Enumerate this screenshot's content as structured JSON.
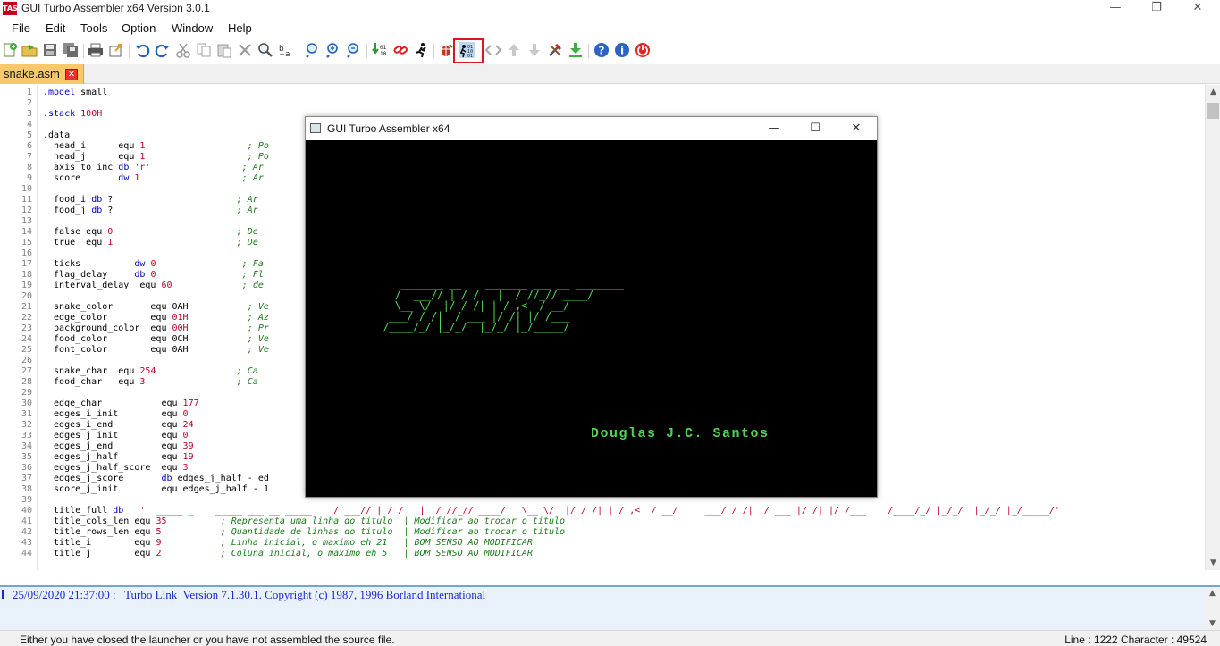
{
  "window": {
    "title": "GUI Turbo Assembler x64 Version 3.0.1",
    "app_icon_text": "TASM",
    "minimize": "—",
    "maximize": "❐",
    "close": "✕"
  },
  "menu": [
    "File",
    "Edit",
    "Tools",
    "Option",
    "Window",
    "Help"
  ],
  "toolbar": {
    "icons": [
      "new-file-icon",
      "open-file-icon",
      "save-icon",
      "save-all-icon",
      "print-icon",
      "export-icon",
      "undo-icon",
      "redo-icon",
      "cut-icon",
      "copy-icon",
      "paste-icon",
      "delete-icon",
      "find-icon",
      "replace-icon",
      "zoom-in-icon",
      "zoom-reset-icon",
      "zoom-out-icon",
      "assemble-icon",
      "link-icon",
      "run-icon",
      "debug-icon",
      "launcher-icon",
      "navigate-icon",
      "step-up-icon",
      "step-down-icon",
      "build-tools-icon",
      "download-icon",
      "help-icon",
      "info-icon",
      "power-icon"
    ],
    "selected": "launcher-icon"
  },
  "tab": {
    "label": "snake.asm",
    "close": "✕"
  },
  "editor": {
    "lines": [
      {
        "n": "1",
        "html": "<span class='dir'>.model</span> small"
      },
      {
        "n": "2",
        "html": ""
      },
      {
        "n": "3",
        "html": "<span class='dir'>.stack</span> <span class='num'>100H</span>"
      },
      {
        "n": "4",
        "html": ""
      },
      {
        "n": "5",
        "html": ".data"
      },
      {
        "n": "6",
        "html": "  head_i      equ <span class='num'>1</span>                   <span class='cm'>; Po</span>"
      },
      {
        "n": "7",
        "html": "  head_j      equ <span class='num'>1</span>                   <span class='cm'>; Po</span>"
      },
      {
        "n": "8",
        "html": "  axis_to_inc <span class='kw'>db</span> <span class='str'>'r'</span>                 <span class='cm'>; Ar</span>"
      },
      {
        "n": "9",
        "html": "  score       <span class='kw'>dw</span> <span class='num'>1</span>                   <span class='cm'>; Ar</span>"
      },
      {
        "n": "10",
        "html": ""
      },
      {
        "n": "11",
        "html": "  food_i <span class='kw'>db</span> ?                       <span class='cm'>; Ar</span>"
      },
      {
        "n": "12",
        "html": "  food_j <span class='kw'>db</span> ?                       <span class='cm'>; Ar</span>"
      },
      {
        "n": "13",
        "html": ""
      },
      {
        "n": "14",
        "html": "  false equ <span class='num'>0</span>                       <span class='cm'>; De</span>"
      },
      {
        "n": "15",
        "html": "  true  equ <span class='num'>1</span>                       <span class='cm'>; De</span>"
      },
      {
        "n": "16",
        "html": ""
      },
      {
        "n": "17",
        "html": "  ticks          <span class='kw'>dw</span> <span class='num'>0</span>                <span class='cm'>; Fa</span>"
      },
      {
        "n": "18",
        "html": "  flag_delay     <span class='kw'>db</span> <span class='num'>0</span>                <span class='cm'>; Fl</span>"
      },
      {
        "n": "19",
        "html": "  interval_delay  equ <span class='num'>60</span>             <span class='cm'>; de</span>"
      },
      {
        "n": "20",
        "html": ""
      },
      {
        "n": "21",
        "html": "  snake_color       equ 0AH           <span class='cm'>; Ve</span>"
      },
      {
        "n": "22",
        "html": "  edge_color        equ <span class='num'>01H</span>           <span class='cm'>; Az</span>"
      },
      {
        "n": "23",
        "html": "  background_color  equ <span class='num'>00H</span>           <span class='cm'>; Pr</span>"
      },
      {
        "n": "24",
        "html": "  food_color        equ 0CH           <span class='cm'>; Ve</span>"
      },
      {
        "n": "25",
        "html": "  font_color        equ 0AH           <span class='cm'>; Ve</span>"
      },
      {
        "n": "26",
        "html": ""
      },
      {
        "n": "27",
        "html": "  snake_char  equ <span class='num'>254</span>               <span class='cm'>; Ca</span>"
      },
      {
        "n": "28",
        "html": "  food_char   equ <span class='num'>3</span>                 <span class='cm'>; Ca</span>"
      },
      {
        "n": "29",
        "html": ""
      },
      {
        "n": "30",
        "html": "  edge_char           equ <span class='num'>177</span>"
      },
      {
        "n": "31",
        "html": "  edges_i_init        equ <span class='num'>0</span>"
      },
      {
        "n": "32",
        "html": "  edges_i_end         equ <span class='num'>24</span>"
      },
      {
        "n": "33",
        "html": "  edges_j_init        equ <span class='num'>0</span>"
      },
      {
        "n": "34",
        "html": "  edges_j_end         equ <span class='num'>39</span>"
      },
      {
        "n": "35",
        "html": "  edges_j_half        equ <span class='num'>19</span>"
      },
      {
        "n": "36",
        "html": "  edges_j_half_score  equ <span class='num'>3</span>"
      },
      {
        "n": "37",
        "html": "  edges_j_score       <span class='kw'>db</span> edges_j_half - ed"
      },
      {
        "n": "38",
        "html": "  score_j_init        equ edges_j_half - 1"
      },
      {
        "n": "39",
        "html": ""
      },
      {
        "n": "40",
        "html": "  title_full <span class='kw'>db</span>   <span class='str'>'  _____ _    _____ ___ __ _____    / ___// | / /   |  / //_// ____/   \\__ \\/  |/ / /| | / ,<  / __/     ___/ / /|  / ___ |/ /| |/ /___    /____/_/ |_/_/  |_/_/ |_/_____/'</span>"
      },
      {
        "n": "41",
        "html": "  title_cols_len equ <span class='num'>35</span>          <span class='cm'>; Representa uma linha do titulo  | Modificar ao trocar o titulo</span>"
      },
      {
        "n": "42",
        "html": "  title_rows_len equ <span class='num'>5</span>           <span class='cm'>; Quantidade de linhas do titulo  | Modificar ao trocar o titulo</span>"
      },
      {
        "n": "43",
        "html": "  title_i        equ <span class='num'>9</span>           <span class='cm'>; Linha inicial, o maximo eh 21   | BOM SENSO AO MODIFICAR</span>"
      },
      {
        "n": "44",
        "html": "  title_j        equ <span class='num'>2</span>           <span class='cm'>; Coluna inicial, o maximo eh 5   | BOM SENSO AO MODIFICAR</span>"
      }
    ]
  },
  "dosbox": {
    "title": "GUI Turbo Assembler x64",
    "minimize": "—",
    "maximize": "☐",
    "close": "✕",
    "art": "         _______ __    _______ ___ __ ________\n        /  ___// | / /   |  / //_// ____/\n        \\__ \\/  |/ / /| | / ,<  / __/\n       ___/ / /|  / ___ |/ /| |/ /___\n      /____/_/ |_/_/  |_/_/ |_/_____/",
    "author": "Douglas J.C. Santos"
  },
  "output": {
    "line": "25/09/2020 21:37:00 :   Turbo Link  Version 7.1.30.1. Copyright (c) 1987, 1996 Borland International"
  },
  "status": {
    "message": "Either you have closed the launcher or you have not assembled the source file.",
    "position": "Line : 1222 Character : 49524"
  }
}
